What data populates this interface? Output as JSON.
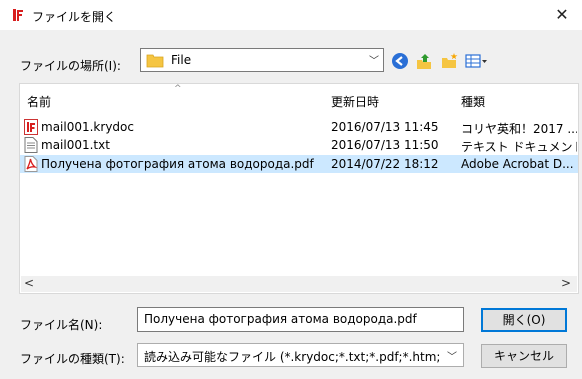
{
  "window": {
    "title": "ファイルを開く",
    "close_glyph": "✕"
  },
  "location": {
    "label": "ファイルの場所(I):",
    "value": "File"
  },
  "list": {
    "columns": {
      "name": "名前",
      "modified": "更新日時",
      "type": "種類"
    },
    "files": [
      {
        "name": "mail001.krydoc",
        "modified": "2016/07/13 11:45",
        "type": "コリヤ英和！2017 ...",
        "icon": "krydoc-icon",
        "selected": false
      },
      {
        "name": "mail001.txt",
        "modified": "2016/07/13 11:50",
        "type": "テキスト ドキュメント",
        "icon": "text-file-icon",
        "selected": false
      },
      {
        "name": "Получена фотография атома водорода.pdf",
        "modified": "2014/07/22 18:12",
        "type": "Adobe Acrobat D...",
        "icon": "pdf-icon",
        "selected": true
      }
    ]
  },
  "filename": {
    "label": "ファイル名(N):",
    "value": "Получена фотография атома водорода.pdf"
  },
  "filetype": {
    "label": "ファイルの種類(T):",
    "value": "読み込み可能なファイル (*.krydoc;*.txt;*.pdf;*.htm;*ht"
  },
  "buttons": {
    "open": "開く(O)",
    "cancel": "キャンセル"
  },
  "colors": {
    "selection": "#cce8ff",
    "accent": "#0078d7"
  }
}
